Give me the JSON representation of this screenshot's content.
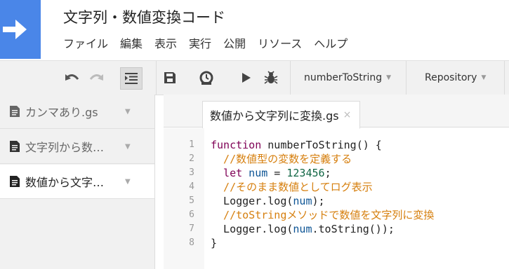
{
  "app": {
    "title": "文字列・数値変換コード",
    "menu": [
      "ファイル",
      "編集",
      "表示",
      "実行",
      "公開",
      "リソース",
      "ヘルプ"
    ],
    "colors": {
      "brand": "#4a86e8",
      "comment": "#d67f0e",
      "keyword": "#7f0055",
      "number": "#116644",
      "variable": "#0b5394"
    }
  },
  "toolbar": {
    "icons": [
      "undo-icon",
      "redo-icon",
      "indent-icon",
      "save-icon",
      "trigger-clock-icon",
      "run-icon",
      "debug-bug-icon"
    ],
    "function_select": "numberToString",
    "repository_select": "Repository"
  },
  "sidebar": {
    "files": [
      {
        "name": "カンマあり.gs",
        "active": false
      },
      {
        "name": "文字列から数…",
        "active": false
      },
      {
        "name": "数値から文字…",
        "active": true
      }
    ]
  },
  "editor": {
    "tab_label": "数値から文字列に変換.gs",
    "tab_close": "×",
    "line_numbers": [
      "1",
      "2",
      "3",
      "4",
      "5",
      "6",
      "7",
      "8"
    ],
    "lines": [
      {
        "kw": "function",
        "rest": " numberToString() {"
      },
      {
        "comment": "  //数値型の変数を定義する"
      },
      {
        "kw": "  let",
        "var": " num",
        "mid": " = ",
        "num": "123456",
        "end": ";"
      },
      {
        "comment": "  //そのまま数値としてログ表示"
      },
      {
        "pre": "  Logger.log(",
        "var": "num",
        "end": ");"
      },
      {
        "comment": "  //toStringメソッドで数値を文字列に変換"
      },
      {
        "pre": "  Logger.log(",
        "var": "num",
        "end": ".toString());"
      },
      {
        "rest": "}"
      }
    ]
  }
}
